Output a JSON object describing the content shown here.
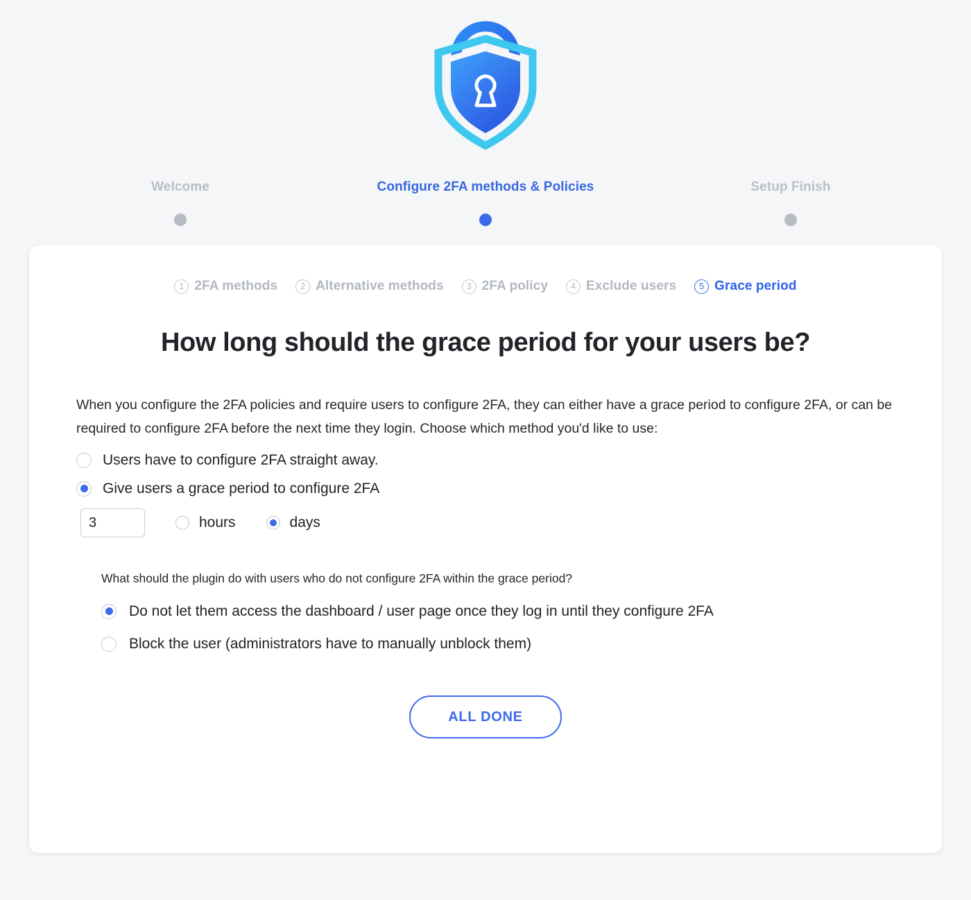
{
  "logo": {
    "name": "two-factor-shield-lock-logo",
    "colors": {
      "cyan": "#3ec8f0",
      "blue_dark": "#2f5fe0",
      "blue_light": "#2d8ef5"
    }
  },
  "wizard": {
    "steps": [
      {
        "label": "Welcome",
        "active": false
      },
      {
        "label": "Configure 2FA methods & Policies",
        "active": true
      },
      {
        "label": "Setup Finish",
        "active": false
      }
    ],
    "active_color": "#3867e0",
    "inactive_color": "#b9bec7"
  },
  "substeps": [
    {
      "num": "1",
      "label": "2FA methods",
      "active": false
    },
    {
      "num": "2",
      "label": "Alternative methods",
      "active": false
    },
    {
      "num": "3",
      "label": "2FA policy",
      "active": false
    },
    {
      "num": "4",
      "label": "Exclude users",
      "active": false
    },
    {
      "num": "5",
      "label": "Grace period",
      "active": true
    }
  ],
  "main": {
    "headline": "How long should the grace period for your users be?",
    "intro": "When you configure the 2FA policies and require users to configure 2FA, they can either have a grace period to configure 2FA, or can be required to configure 2FA before the next time they login. Choose which method you'd like to use:",
    "grace_options": [
      {
        "label": "Users have to configure 2FA straight away.",
        "checked": false
      },
      {
        "label": "Give users a grace period to configure 2FA",
        "checked": true
      }
    ],
    "duration": {
      "value": "3",
      "units": [
        {
          "label": "hours",
          "checked": false
        },
        {
          "label": "days",
          "checked": true
        }
      ]
    },
    "subquestion": "What should the plugin do with users who do not configure 2FA within the grace period?",
    "consequence_options": [
      {
        "label": "Do not let them access the dashboard / user page once they log in until they configure 2FA",
        "checked": true
      },
      {
        "label": "Block the user (administrators have to manually unblock them)",
        "checked": false
      }
    ],
    "submit_label": "ALL DONE"
  }
}
